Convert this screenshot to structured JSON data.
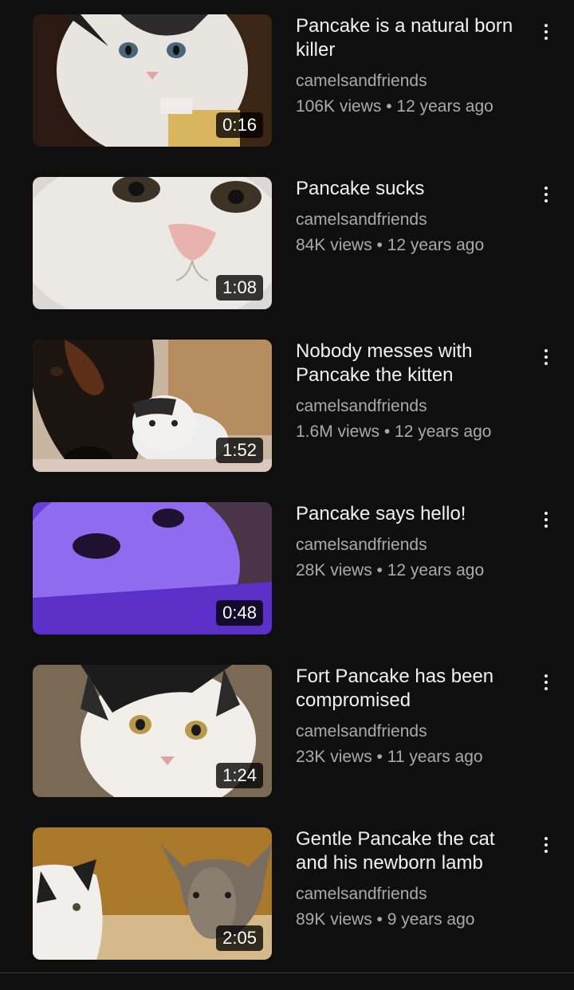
{
  "videos": [
    {
      "title": "Pancake is a natural born killer",
      "channel": "camelsandfriends",
      "stats": "106K views • 12 years ago",
      "duration": "0:16",
      "thumb_desc": "kitten-closeup"
    },
    {
      "title": "Pancake sucks",
      "channel": "camelsandfriends",
      "stats": "84K views • 12 years ago",
      "duration": "1:08",
      "thumb_desc": "cat-face-closeup"
    },
    {
      "title": "Nobody messes with Pancake the kitten",
      "channel": "camelsandfriends",
      "stats": "1.6M views • 12 years ago",
      "duration": "1:52",
      "thumb_desc": "kitten-with-dogs"
    },
    {
      "title": "Pancake says hello!",
      "channel": "camelsandfriends",
      "stats": "28K views • 12 years ago",
      "duration": "0:48",
      "thumb_desc": "cat-purple-light"
    },
    {
      "title": "Fort Pancake has been compromised",
      "channel": "camelsandfriends",
      "stats": "23K views • 11 years ago",
      "duration": "1:24",
      "thumb_desc": "cat-peeking"
    },
    {
      "title": "Gentle Pancake the cat and his newborn lamb",
      "channel": "camelsandfriends",
      "stats": "89K views • 9 years ago",
      "duration": "2:05",
      "thumb_desc": "cat-and-lamb"
    }
  ],
  "icons": {
    "more": "more-vert-icon"
  }
}
